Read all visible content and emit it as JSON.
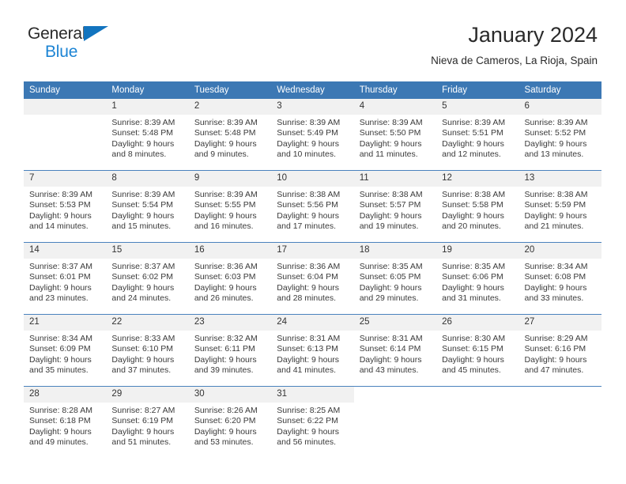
{
  "brand": {
    "line1": "General",
    "line2": "Blue",
    "triangle_color": "#1274bf",
    "text_color_line1": "#2b2b2b",
    "text_color_line2": "#1c84d4"
  },
  "header": {
    "title": "January 2024",
    "location": "Nieva de Cameros, La Rioja, Spain"
  },
  "colors": {
    "header_row_bg": "#3c78b4",
    "header_row_text": "#ffffff",
    "daynum_bg": "#f1f1f1",
    "week_divider": "#4a82bd",
    "cell_text": "#3a3a3a"
  },
  "weekday_headers": [
    "Sunday",
    "Monday",
    "Tuesday",
    "Wednesday",
    "Thursday",
    "Friday",
    "Saturday"
  ],
  "weeks": [
    [
      {
        "day": "",
        "empty": true,
        "sunrise": "",
        "sunset": "",
        "daylight1": "",
        "daylight2": ""
      },
      {
        "day": "1",
        "sunrise": "Sunrise: 8:39 AM",
        "sunset": "Sunset: 5:48 PM",
        "daylight1": "Daylight: 9 hours",
        "daylight2": "and 8 minutes."
      },
      {
        "day": "2",
        "sunrise": "Sunrise: 8:39 AM",
        "sunset": "Sunset: 5:48 PM",
        "daylight1": "Daylight: 9 hours",
        "daylight2": "and 9 minutes."
      },
      {
        "day": "3",
        "sunrise": "Sunrise: 8:39 AM",
        "sunset": "Sunset: 5:49 PM",
        "daylight1": "Daylight: 9 hours",
        "daylight2": "and 10 minutes."
      },
      {
        "day": "4",
        "sunrise": "Sunrise: 8:39 AM",
        "sunset": "Sunset: 5:50 PM",
        "daylight1": "Daylight: 9 hours",
        "daylight2": "and 11 minutes."
      },
      {
        "day": "5",
        "sunrise": "Sunrise: 8:39 AM",
        "sunset": "Sunset: 5:51 PM",
        "daylight1": "Daylight: 9 hours",
        "daylight2": "and 12 minutes."
      },
      {
        "day": "6",
        "sunrise": "Sunrise: 8:39 AM",
        "sunset": "Sunset: 5:52 PM",
        "daylight1": "Daylight: 9 hours",
        "daylight2": "and 13 minutes."
      }
    ],
    [
      {
        "day": "7",
        "sunrise": "Sunrise: 8:39 AM",
        "sunset": "Sunset: 5:53 PM",
        "daylight1": "Daylight: 9 hours",
        "daylight2": "and 14 minutes."
      },
      {
        "day": "8",
        "sunrise": "Sunrise: 8:39 AM",
        "sunset": "Sunset: 5:54 PM",
        "daylight1": "Daylight: 9 hours",
        "daylight2": "and 15 minutes."
      },
      {
        "day": "9",
        "sunrise": "Sunrise: 8:39 AM",
        "sunset": "Sunset: 5:55 PM",
        "daylight1": "Daylight: 9 hours",
        "daylight2": "and 16 minutes."
      },
      {
        "day": "10",
        "sunrise": "Sunrise: 8:38 AM",
        "sunset": "Sunset: 5:56 PM",
        "daylight1": "Daylight: 9 hours",
        "daylight2": "and 17 minutes."
      },
      {
        "day": "11",
        "sunrise": "Sunrise: 8:38 AM",
        "sunset": "Sunset: 5:57 PM",
        "daylight1": "Daylight: 9 hours",
        "daylight2": "and 19 minutes."
      },
      {
        "day": "12",
        "sunrise": "Sunrise: 8:38 AM",
        "sunset": "Sunset: 5:58 PM",
        "daylight1": "Daylight: 9 hours",
        "daylight2": "and 20 minutes."
      },
      {
        "day": "13",
        "sunrise": "Sunrise: 8:38 AM",
        "sunset": "Sunset: 5:59 PM",
        "daylight1": "Daylight: 9 hours",
        "daylight2": "and 21 minutes."
      }
    ],
    [
      {
        "day": "14",
        "sunrise": "Sunrise: 8:37 AM",
        "sunset": "Sunset: 6:01 PM",
        "daylight1": "Daylight: 9 hours",
        "daylight2": "and 23 minutes."
      },
      {
        "day": "15",
        "sunrise": "Sunrise: 8:37 AM",
        "sunset": "Sunset: 6:02 PM",
        "daylight1": "Daylight: 9 hours",
        "daylight2": "and 24 minutes."
      },
      {
        "day": "16",
        "sunrise": "Sunrise: 8:36 AM",
        "sunset": "Sunset: 6:03 PM",
        "daylight1": "Daylight: 9 hours",
        "daylight2": "and 26 minutes."
      },
      {
        "day": "17",
        "sunrise": "Sunrise: 8:36 AM",
        "sunset": "Sunset: 6:04 PM",
        "daylight1": "Daylight: 9 hours",
        "daylight2": "and 28 minutes."
      },
      {
        "day": "18",
        "sunrise": "Sunrise: 8:35 AM",
        "sunset": "Sunset: 6:05 PM",
        "daylight1": "Daylight: 9 hours",
        "daylight2": "and 29 minutes."
      },
      {
        "day": "19",
        "sunrise": "Sunrise: 8:35 AM",
        "sunset": "Sunset: 6:06 PM",
        "daylight1": "Daylight: 9 hours",
        "daylight2": "and 31 minutes."
      },
      {
        "day": "20",
        "sunrise": "Sunrise: 8:34 AM",
        "sunset": "Sunset: 6:08 PM",
        "daylight1": "Daylight: 9 hours",
        "daylight2": "and 33 minutes."
      }
    ],
    [
      {
        "day": "21",
        "sunrise": "Sunrise: 8:34 AM",
        "sunset": "Sunset: 6:09 PM",
        "daylight1": "Daylight: 9 hours",
        "daylight2": "and 35 minutes."
      },
      {
        "day": "22",
        "sunrise": "Sunrise: 8:33 AM",
        "sunset": "Sunset: 6:10 PM",
        "daylight1": "Daylight: 9 hours",
        "daylight2": "and 37 minutes."
      },
      {
        "day": "23",
        "sunrise": "Sunrise: 8:32 AM",
        "sunset": "Sunset: 6:11 PM",
        "daylight1": "Daylight: 9 hours",
        "daylight2": "and 39 minutes."
      },
      {
        "day": "24",
        "sunrise": "Sunrise: 8:31 AM",
        "sunset": "Sunset: 6:13 PM",
        "daylight1": "Daylight: 9 hours",
        "daylight2": "and 41 minutes."
      },
      {
        "day": "25",
        "sunrise": "Sunrise: 8:31 AM",
        "sunset": "Sunset: 6:14 PM",
        "daylight1": "Daylight: 9 hours",
        "daylight2": "and 43 minutes."
      },
      {
        "day": "26",
        "sunrise": "Sunrise: 8:30 AM",
        "sunset": "Sunset: 6:15 PM",
        "daylight1": "Daylight: 9 hours",
        "daylight2": "and 45 minutes."
      },
      {
        "day": "27",
        "sunrise": "Sunrise: 8:29 AM",
        "sunset": "Sunset: 6:16 PM",
        "daylight1": "Daylight: 9 hours",
        "daylight2": "and 47 minutes."
      }
    ],
    [
      {
        "day": "28",
        "sunrise": "Sunrise: 8:28 AM",
        "sunset": "Sunset: 6:18 PM",
        "daylight1": "Daylight: 9 hours",
        "daylight2": "and 49 minutes."
      },
      {
        "day": "29",
        "sunrise": "Sunrise: 8:27 AM",
        "sunset": "Sunset: 6:19 PM",
        "daylight1": "Daylight: 9 hours",
        "daylight2": "and 51 minutes."
      },
      {
        "day": "30",
        "sunrise": "Sunrise: 8:26 AM",
        "sunset": "Sunset: 6:20 PM",
        "daylight1": "Daylight: 9 hours",
        "daylight2": "and 53 minutes."
      },
      {
        "day": "31",
        "sunrise": "Sunrise: 8:25 AM",
        "sunset": "Sunset: 6:22 PM",
        "daylight1": "Daylight: 9 hours",
        "daylight2": "and 56 minutes."
      },
      {
        "day": "",
        "blank": true,
        "sunrise": "",
        "sunset": "",
        "daylight1": "",
        "daylight2": ""
      },
      {
        "day": "",
        "blank": true,
        "sunrise": "",
        "sunset": "",
        "daylight1": "",
        "daylight2": ""
      },
      {
        "day": "",
        "blank": true,
        "sunrise": "",
        "sunset": "",
        "daylight1": "",
        "daylight2": ""
      }
    ]
  ]
}
